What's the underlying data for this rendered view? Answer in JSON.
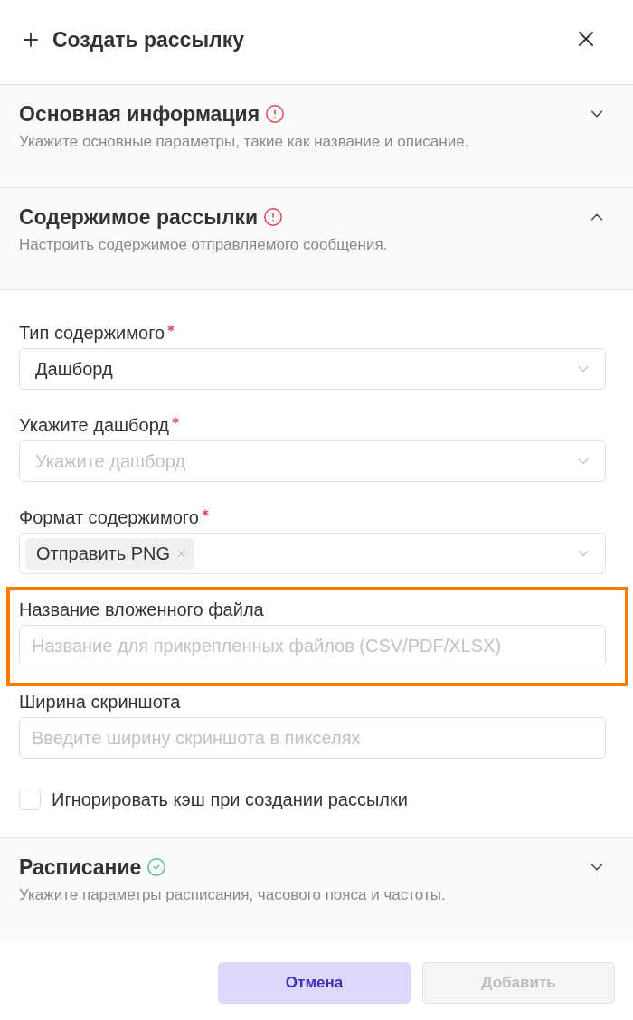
{
  "header": {
    "title": "Создать рассылку"
  },
  "sections": [
    {
      "title": "Основная информация",
      "valid": false,
      "description": "Укажите основные параметры, такие как название и описание.",
      "expanded": false
    },
    {
      "title": "Содержимое рассылки",
      "valid": false,
      "description": "Настроить содержимое отправляемого сообщения.",
      "expanded": true,
      "fields": [
        {
          "kind": "select",
          "label": "Тип содержимого",
          "required": true,
          "value": "Дашборд"
        },
        {
          "kind": "select",
          "label": "Укажите дашборд",
          "required": true,
          "placeholder": "Укажите дашборд"
        },
        {
          "kind": "multiselect",
          "label": "Формат содержимого",
          "required": true,
          "tags": [
            "Отправить PNG"
          ]
        },
        {
          "kind": "input",
          "label": "Название вложенного файла",
          "required": false,
          "highlighted": true,
          "placeholder": "Название для прикрепленных файлов (CSV/PDF/XLSX)"
        },
        {
          "kind": "input",
          "label": "Ширина скриншота",
          "required": false,
          "highlighted": false,
          "placeholder": "Введите ширину скриншота в пикселях"
        },
        {
          "kind": "checkbox",
          "label": "Игнорировать кэш при создании рассылки",
          "checked": false
        }
      ]
    },
    {
      "title": "Расписание",
      "valid": true,
      "description": "Укажите параметры расписания, часового пояса и частоты.",
      "expanded": false
    }
  ],
  "footer": {
    "buttons": [
      {
        "label": "Отмена",
        "kind": "secondary",
        "disabled": false
      },
      {
        "label": "Добавить",
        "kind": "primary",
        "disabled": true
      }
    ]
  }
}
